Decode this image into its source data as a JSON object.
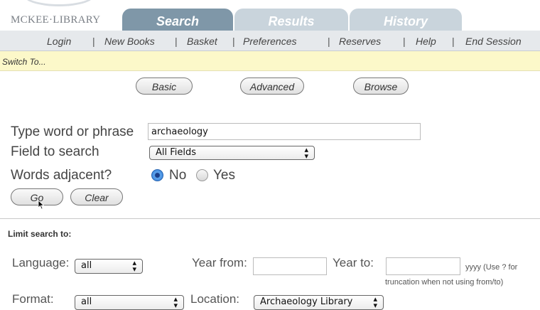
{
  "header": {
    "logo": "MCKEE·LIBRARY",
    "tabs": [
      {
        "label": "Search",
        "state": "active"
      },
      {
        "label": "Results",
        "state": "inactive"
      },
      {
        "label": "History",
        "state": "inactive"
      }
    ]
  },
  "nav": {
    "items": [
      "Login",
      "New Books",
      "Basket",
      "Preferences",
      "Reserves",
      "Help",
      "End Session"
    ],
    "separator": "|"
  },
  "switch_to": "Switch To...",
  "modes": [
    "Basic",
    "Advanced",
    "Browse"
  ],
  "form": {
    "query_label": "Type word or phrase",
    "query_value": "archaeology",
    "field_label": "Field to search",
    "field_value": "All Fields",
    "adjacent_label": "Words adjacent?",
    "adjacent_options": [
      "No",
      "Yes"
    ],
    "adjacent_selected": "No",
    "go_label": "Go",
    "clear_label": "Clear"
  },
  "limits": {
    "heading": "Limit search to:",
    "language_label": "Language:",
    "language_value": "all",
    "year_from_label": "Year from:",
    "year_to_label": "Year to:",
    "year_hint_1": "yyyy (Use ? for",
    "year_hint_2": "truncation when not using from/to)",
    "format_label": "Format:",
    "format_value": "all",
    "location_label": "Location:",
    "location_value": "Archaeology Library"
  },
  "colors": {
    "tab_active": "#7f97a8",
    "tab_inactive": "#c9d4dc",
    "nav_bg": "#e6e9ec",
    "switch_bg": "#fcf8c9",
    "radio_on": "#2e79d6"
  },
  "icons": {
    "select_arrow": "updown-arrows-icon",
    "cursor": "mouse-pointer-icon"
  }
}
